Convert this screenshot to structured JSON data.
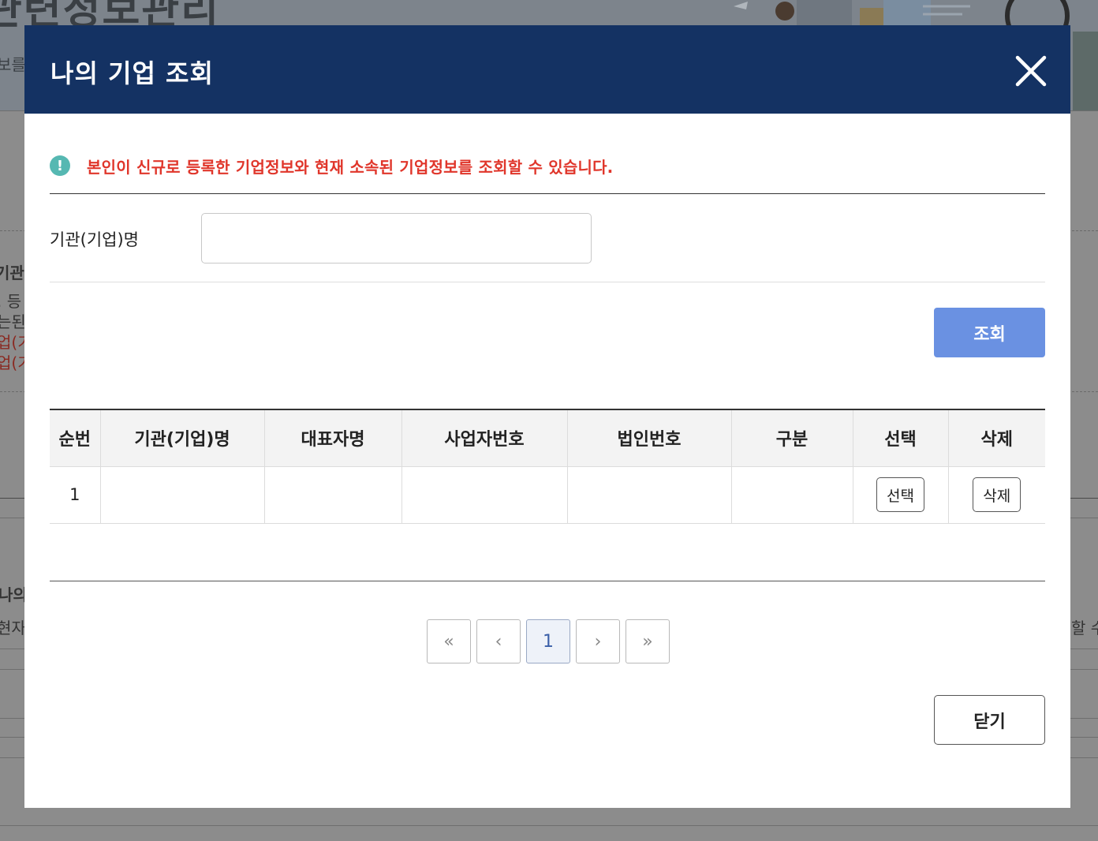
{
  "background": {
    "hero_title": "관련정보관리",
    "hero_sub": "보를",
    "side_heading": "기관)",
    "side_lines": [
      ". 등",
      "는된"
    ],
    "side_red_lines": [
      "업(기",
      "업(기"
    ],
    "section_title": "나의",
    "section_text": "현자",
    "section_text_right": "할 수"
  },
  "modal": {
    "title": "나의 기업 조회",
    "notice": "본인이 신규로 등록한 기업정보와 현재 소속된 기업정보를 조회할 수 있습니다.",
    "search": {
      "label": "기관(기업)명",
      "value": "",
      "placeholder": ""
    },
    "search_button": "조회",
    "table": {
      "headers": [
        "순번",
        "기관(기업)명",
        "대표자명",
        "사업자번호",
        "법인번호",
        "구분",
        "선택",
        "삭제"
      ],
      "rows": [
        {
          "no": "1",
          "name": "",
          "ceo": "",
          "biz_no": "",
          "corp_no": "",
          "type": "",
          "select_label": "선택",
          "delete_label": "삭제"
        }
      ]
    },
    "pagination": {
      "first": "«",
      "prev": "‹",
      "current": "1",
      "next": "›",
      "last": "»"
    },
    "close_button": "닫기"
  },
  "colors": {
    "header_bg": "#143263",
    "notice_red": "#e0362b",
    "notice_icon": "#56b8b2",
    "primary_button": "#6a91e2"
  }
}
